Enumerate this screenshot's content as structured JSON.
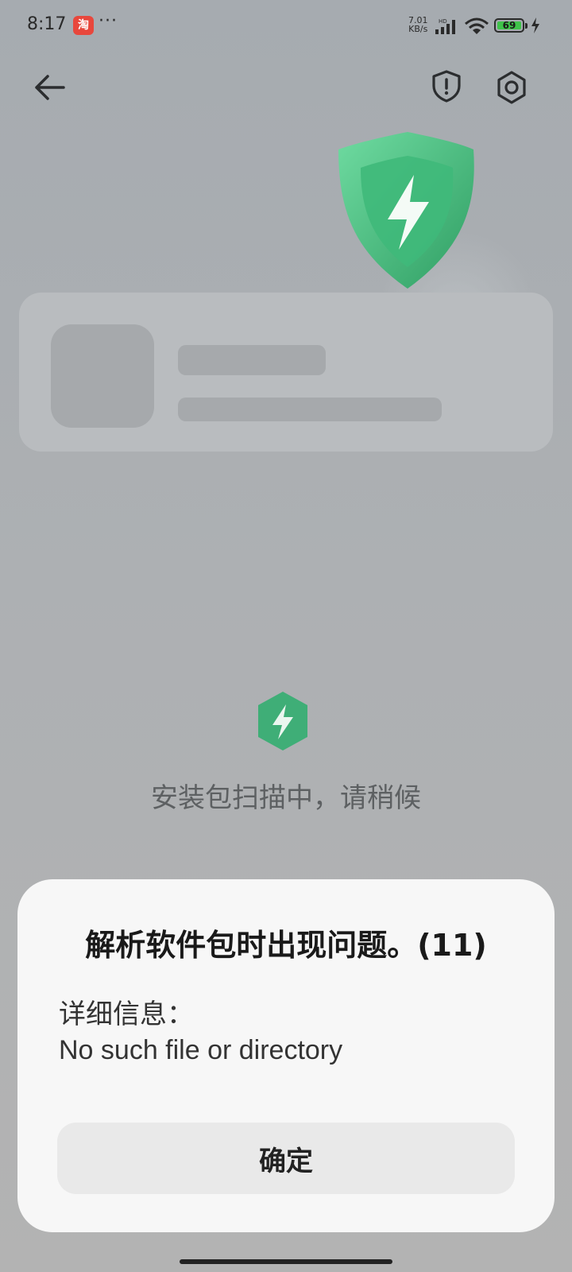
{
  "status_bar": {
    "time": "8:17",
    "app_icon_glyph": "淘",
    "more": "···",
    "net_speed_value": "7.01",
    "net_speed_unit": "KB/s",
    "hd": "HD",
    "battery_level": "69",
    "colors": {
      "battery_fill": "#3fc34a"
    }
  },
  "header": {
    "back_icon": "arrow-left-icon",
    "report_icon": "shield-exclamation-icon",
    "settings_icon": "settings-hexagon-icon"
  },
  "scan": {
    "text": "安装包扫描中，请稍候",
    "icon": "shield-bolt-icon",
    "accent": "#3fae77"
  },
  "dialog": {
    "title": "解析软件包时出现问题。(11)",
    "details_label": "详细信息：",
    "details_message": "No such file or directory",
    "confirm_label": "确定"
  }
}
